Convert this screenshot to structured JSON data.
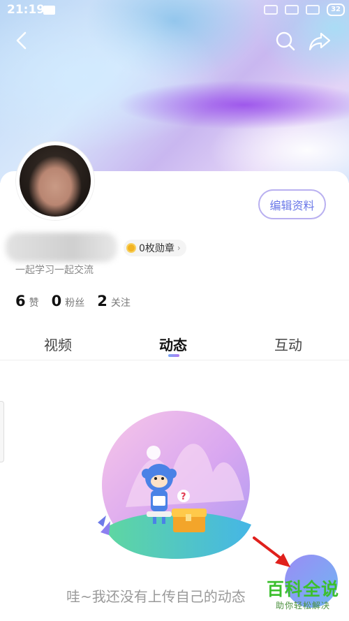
{
  "status_bar": {
    "time": "21:19",
    "battery": "32"
  },
  "profile": {
    "edit_button": "编辑资料",
    "badge": "0枚勋章",
    "bio": "一起学习一起交流",
    "stats": [
      {
        "count": "6",
        "label": "赞"
      },
      {
        "count": "0",
        "label": "粉丝"
      },
      {
        "count": "2",
        "label": "关注"
      }
    ]
  },
  "tabs": [
    {
      "label": "视频",
      "active": false
    },
    {
      "label": "动态",
      "active": true
    },
    {
      "label": "互动",
      "active": false
    }
  ],
  "empty_state": {
    "message": "哇~我还没有上传自己的动态"
  },
  "watermark": {
    "title": "百科全说",
    "subtitle": "助你轻松解决"
  },
  "colors": {
    "accent": "#6a78e8",
    "tab_indicator": "#9a8cf5",
    "watermark": "#3cbf2e",
    "arrow": "#e0201c"
  }
}
